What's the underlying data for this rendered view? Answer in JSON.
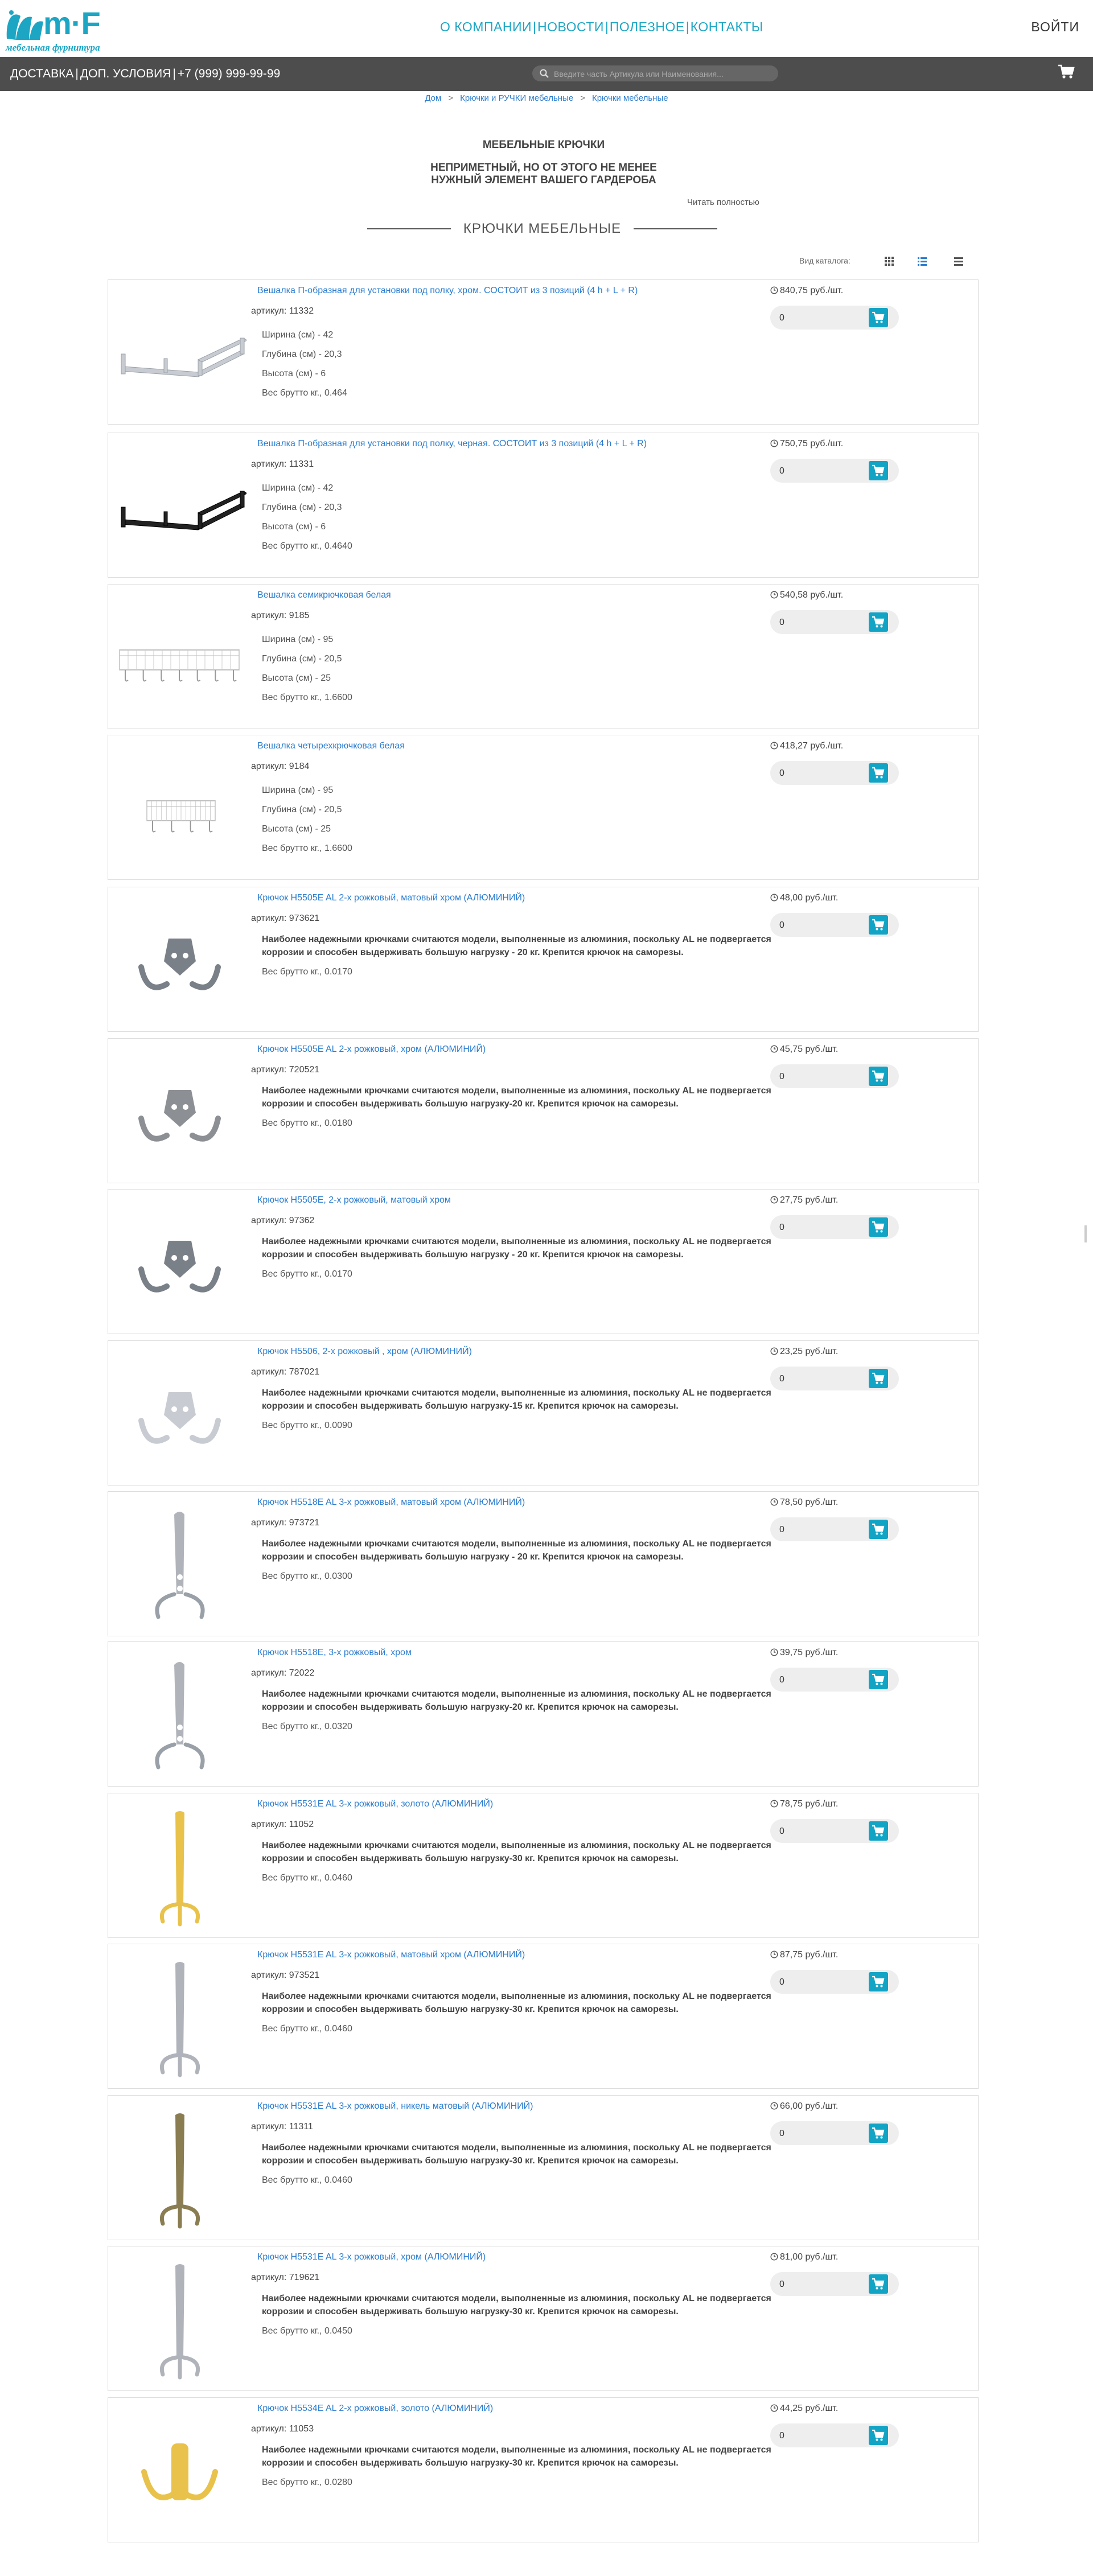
{
  "header": {
    "logo_text": "m·F",
    "logo_sub": "мебельная фурнитура",
    "nav": [
      "О КОМПАНИИ",
      "НОВОСТИ",
      "ПОЛЕЗНОЕ",
      "КОНТАКТЫ"
    ],
    "login": "ВОЙТИ"
  },
  "subbar": {
    "links": [
      "ДОСТАВКА",
      "ДОП. УСЛОВИЯ",
      "+7 (999) 999-99-99"
    ],
    "search_placeholder": "Введите часть Артикула или Наименования..."
  },
  "breadcrumb": [
    "Дом",
    "Крючки и РУЧКИ мебельные",
    "Крючки мебельные"
  ],
  "intro": {
    "title": "МЕБЕЛЬНЫЕ КРЮЧКИ",
    "line1": "НЕПРИМЕТНЫЙ, НО ОТ ЭТОГО НЕ МЕНЕЕ",
    "line2": "НУЖНЫЙ ЭЛЕМЕНТ ВАШЕГО ГАРДЕРОБА",
    "read_more": "Читать полностью"
  },
  "section_title": "КРЮЧКИ МЕБЕЛЬНЫЕ",
  "view_label": "Вид каталога:",
  "sku_prefix": "артикул:",
  "products": [
    {
      "title": "Вешалка П-образная для установки под полку, хром. СОСТОИТ из 3 позиций (4 h + L + R)",
      "sku": "11332",
      "props": [
        "Ширина (см) - 42",
        "Глубина (см) - 20,3",
        "Высота (см) - 6",
        "Вес брутто кг., 0.464"
      ],
      "price": "840,75 руб./шт.",
      "qty": "0",
      "img": "rail-chrome"
    },
    {
      "title": "Вешалка П-образная для установки под полку, черная. СОСТОИТ из 3 позиций (4 h + L + R)",
      "sku": "11331",
      "props": [
        "Ширина (см) - 42",
        "Глубина (см) - 20,3",
        "Высота (см) - 6",
        "Вес брутто кг., 0.4640"
      ],
      "price": "750,75 руб./шт.",
      "qty": "0",
      "img": "rail-black"
    },
    {
      "title": "Вешалка семикрючковая белая",
      "sku": "9185",
      "props": [
        "Ширина (см) - 95",
        "Глубина (см) - 20,5",
        "Высота (см) - 25",
        "Вес брутто кг., 1.6600"
      ],
      "price": "540,58 руб./шт.",
      "qty": "0",
      "img": "rack-7"
    },
    {
      "title": "Вешалка четырехкрючковая белая",
      "sku": "9184",
      "props": [
        "Ширина (см) - 95",
        "Глубина (см) - 20,5",
        "Высота (см) - 25",
        "Вес брутто кг., 1.6600"
      ],
      "price": "418,27 руб./шт.",
      "qty": "0",
      "img": "rack-4"
    },
    {
      "title": "Крючок H5505E AL 2-х рожковый, матовый хром (АЛЮМИНИЙ)",
      "sku": "973621",
      "desc": "Наиболее надежными крючками считаются модели, выполненные из алюминия, поскольку AL не подвергается коррозии и способен выдерживать большую нагрузку - 20 кг. Крепится крючок на саморезы.",
      "weight": "Вес брутто кг., 0.0170",
      "price": "48,00 руб./шт.",
      "qty": "0",
      "img": "double-dark"
    },
    {
      "title": "Крючок H5505E AL 2-х рожковый, хром (АЛЮМИНИЙ)",
      "sku": "720521",
      "desc": "Наиболее надежными крючками считаются модели, выполненные из алюминия, поскольку AL не подвергается коррозии и способен выдерживать большую нагрузку-20 кг. Крепится крючок на саморезы.",
      "weight": "Вес брутто кг., 0.0180",
      "price": "45,75 руб./шт.",
      "qty": "0",
      "img": "double-plate"
    },
    {
      "title": "Крючок H5505E, 2-х рожковый, матовый хром",
      "sku": "97362",
      "desc": "Наиболее надежными крючками считаются модели, выполненные из алюминия, поскольку AL не подвергается коррозии и способен выдерживать большую нагрузку - 20 кг. Крепится крючок на саморезы.",
      "weight": "Вес брутто кг., 0.0170",
      "price": "27,75 руб./шт.",
      "qty": "0",
      "img": "double-dark"
    },
    {
      "title": "Крючок H5506, 2-х рожковый , хром (АЛЮМИНИЙ)",
      "sku": "787021",
      "desc": "Наиболее надежными крючками считаются модели, выполненные из алюминия, поскольку AL не подвергается коррозии и способен выдерживать большую нагрузку-15 кг. Крепится крючок на саморезы.",
      "weight": "Вес брутто кг., 0.0090",
      "price": "23,25 руб./шт.",
      "qty": "0",
      "img": "double-light"
    },
    {
      "title": "Крючок H5518E AL 3-х рожковый, матовый хром (АЛЮМИНИЙ)",
      "sku": "973721",
      "desc": "Наиболее надежными крючками считаются модели, выполненные из алюминия, поскольку AL не подвергается коррозии и способен выдерживать большую нагрузку - 20 кг. Крепится крючок на саморезы.",
      "weight": "Вес брутто кг., 0.0300",
      "price": "78,50 руб./шт.",
      "qty": "0",
      "img": "triple-silver"
    },
    {
      "title": "Крючок H5518E, 3-х рожковый, хром",
      "sku": "72022",
      "desc": "Наиболее надежными крючками считаются модели, выполненные из алюминия, поскольку AL не подвергается коррозии и способен выдерживать большую нагрузку-20 кг. Крепится крючок на саморезы.",
      "weight": "Вес брутто кг., 0.0320",
      "price": "39,75 руб./шт.",
      "qty": "0",
      "img": "triple-silver"
    },
    {
      "title": "Крючок H5531E AL 3-х рожковый, золото (АЛЮМИНИЙ)",
      "sku": "11052",
      "desc": "Наиболее надежными крючками считаются модели, выполненные из алюминия, поскольку AL не подвергается коррозии и способен выдерживать большую нагрузку-30 кг. Крепится крючок на саморезы.",
      "weight": "Вес брутто кг., 0.0460",
      "price": "78,75 руб./шт.",
      "qty": "0",
      "img": "tall-gold"
    },
    {
      "title": "Крючок H5531E AL 3-х рожковый, матовый хром (АЛЮМИНИЙ)",
      "sku": "973521",
      "desc": "Наиболее надежными крючками считаются модели, выполненные из алюминия, поскольку AL не подвергается коррозии и способен выдерживать большую нагрузку-30 кг. Крепится крючок на саморезы.",
      "weight": "Вес брутто кг., 0.0460",
      "price": "87,75 руб./шт.",
      "qty": "0",
      "img": "tall-silver"
    },
    {
      "title": "Крючок H5531E AL 3-х рожковый, никель матовый (АЛЮМИНИЙ)",
      "sku": "11311",
      "desc": "Наиболее надежными крючками считаются модели, выполненные из алюминия, поскольку AL не подвергается коррозии и способен выдерживать большую нагрузку-30 кг. Крепится крючок на саморезы.",
      "weight": "Вес брутто кг., 0.0460",
      "price": "66,00 руб./шт.",
      "qty": "0",
      "img": "tall-bronze"
    },
    {
      "title": "Крючок H5531E AL 3-х рожковый, хром (АЛЮМИНИЙ)",
      "sku": "719621",
      "desc": "Наиболее надежными крючками считаются модели, выполненные из алюминия, поскольку AL не подвергается коррозии и способен выдерживать большую нагрузку-30 кг. Крепится крючок на саморезы.",
      "weight": "Вес брутто кг., 0.0450",
      "price": "81,00 руб./шт.",
      "qty": "0",
      "img": "tall-silver"
    },
    {
      "title": "Крючок H5534E AL 2-х рожковый, золото (АЛЮМИНИЙ)",
      "sku": "11053",
      "desc": "Наиболее надежными крючками считаются модели, выполненные из алюминия, поскольку AL не подвергается коррозии и способен выдерживать большую нагрузку-30 кг. Крепится крючок на саморезы.",
      "weight": "Вес брутто кг., 0.0280",
      "price": "44,25 руб./шт.",
      "qty": "0",
      "img": "short-gold"
    }
  ],
  "colors": {
    "accent": "#1da6c4",
    "link": "#2a7ccf",
    "bar": "#4d4d4d",
    "cart_button": "#12a4c5"
  }
}
